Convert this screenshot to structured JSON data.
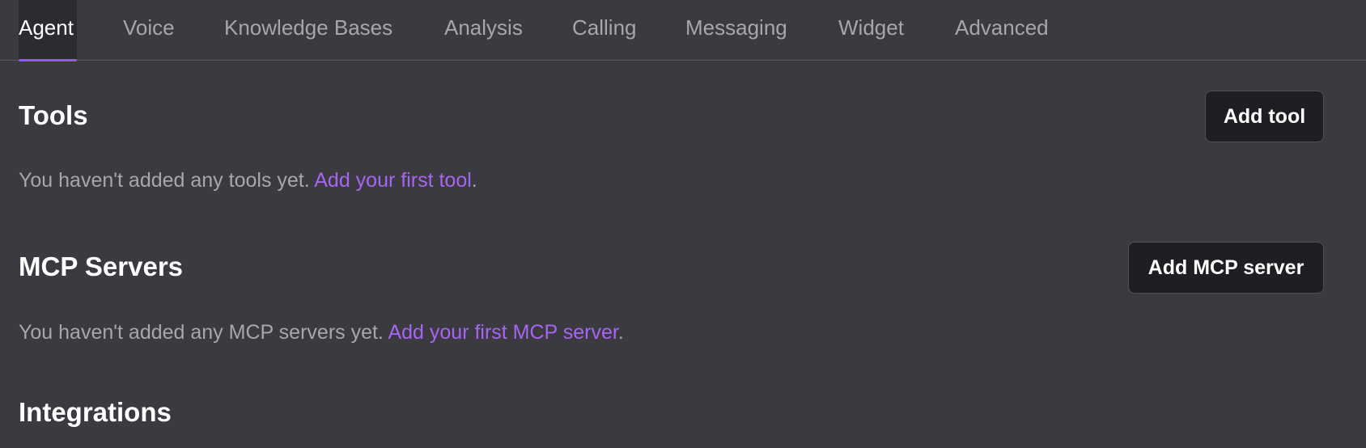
{
  "tabs": [
    {
      "label": "Agent",
      "active": true
    },
    {
      "label": "Voice"
    },
    {
      "label": "Knowledge Bases"
    },
    {
      "label": "Analysis"
    },
    {
      "label": "Calling"
    },
    {
      "label": "Messaging"
    },
    {
      "label": "Widget"
    },
    {
      "label": "Advanced"
    }
  ],
  "tools": {
    "title": "Tools",
    "button_label": "Add tool",
    "empty_text": "You haven't added any tools yet. ",
    "link_text": "Add your first tool",
    "suffix": "."
  },
  "mcp": {
    "title": "MCP Servers",
    "button_label": "Add MCP server",
    "empty_text": "You haven't added any MCP servers yet. ",
    "link_text": "Add your first MCP server",
    "suffix": "."
  },
  "integrations": {
    "title": "Integrations"
  },
  "colors": {
    "background": "#3a3a40",
    "accent": "#8b5cf6",
    "link": "#a766f0",
    "muted_text": "#a6a6ac"
  }
}
